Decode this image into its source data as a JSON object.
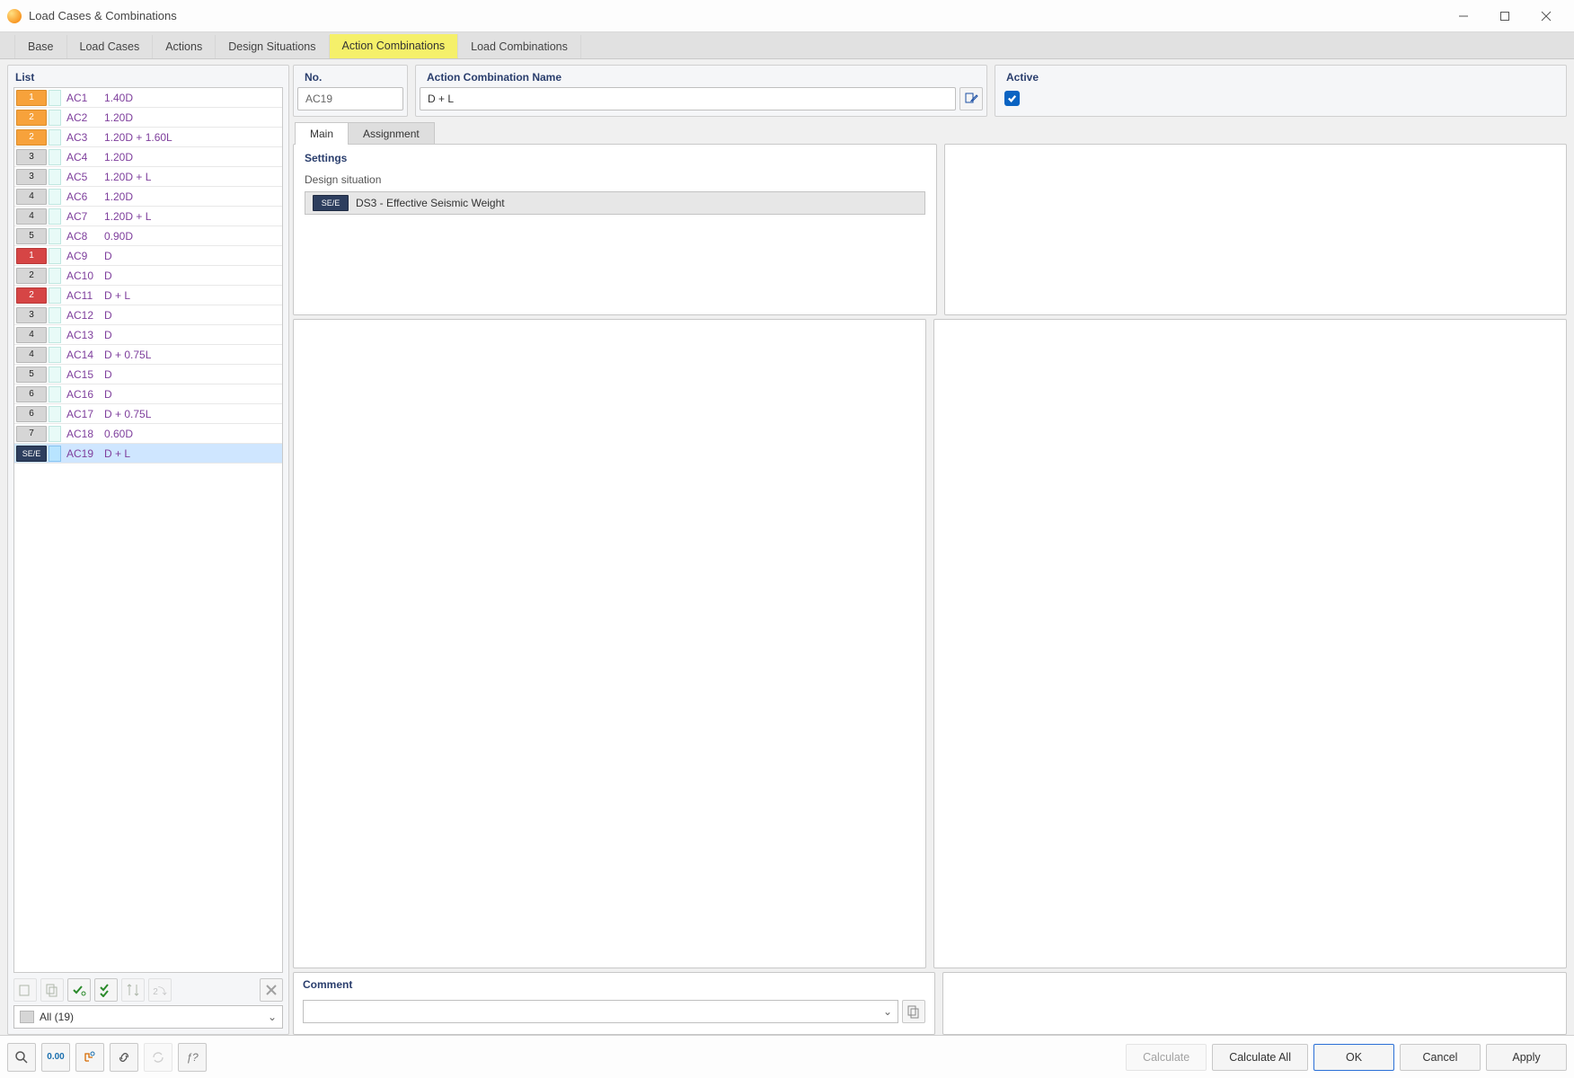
{
  "window": {
    "title": "Load Cases & Combinations"
  },
  "tabs": [
    {
      "label": "Base",
      "active": false
    },
    {
      "label": "Load Cases",
      "active": false
    },
    {
      "label": "Actions",
      "active": false
    },
    {
      "label": "Design Situations",
      "active": false
    },
    {
      "label": "Action Combinations",
      "active": true,
      "highlight": true
    },
    {
      "label": "Load Combinations",
      "active": false
    }
  ],
  "list": {
    "title": "List",
    "filter_label": "All (19)",
    "items": [
      {
        "badge": "1",
        "badge_type": "orange",
        "ac": "AC1",
        "desc": "1.40D",
        "selected": false
      },
      {
        "badge": "2",
        "badge_type": "orange",
        "ac": "AC2",
        "desc": "1.20D",
        "selected": false
      },
      {
        "badge": "2",
        "badge_type": "orange",
        "ac": "AC3",
        "desc": "1.20D + 1.60L",
        "selected": false
      },
      {
        "badge": "3",
        "badge_type": "gray",
        "ac": "AC4",
        "desc": "1.20D",
        "selected": false
      },
      {
        "badge": "3",
        "badge_type": "gray",
        "ac": "AC5",
        "desc": "1.20D + L",
        "selected": false
      },
      {
        "badge": "4",
        "badge_type": "gray",
        "ac": "AC6",
        "desc": "1.20D",
        "selected": false
      },
      {
        "badge": "4",
        "badge_type": "gray",
        "ac": "AC7",
        "desc": "1.20D + L",
        "selected": false
      },
      {
        "badge": "5",
        "badge_type": "gray",
        "ac": "AC8",
        "desc": "0.90D",
        "selected": false
      },
      {
        "badge": "1",
        "badge_type": "red",
        "ac": "AC9",
        "desc": "D",
        "selected": false
      },
      {
        "badge": "2",
        "badge_type": "gray",
        "ac": "AC10",
        "desc": "D",
        "selected": false
      },
      {
        "badge": "2",
        "badge_type": "red",
        "ac": "AC11",
        "desc": "D + L",
        "selected": false
      },
      {
        "badge": "3",
        "badge_type": "gray",
        "ac": "AC12",
        "desc": "D",
        "selected": false
      },
      {
        "badge": "4",
        "badge_type": "gray",
        "ac": "AC13",
        "desc": "D",
        "selected": false
      },
      {
        "badge": "4",
        "badge_type": "gray",
        "ac": "AC14",
        "desc": "D + 0.75L",
        "selected": false
      },
      {
        "badge": "5",
        "badge_type": "gray",
        "ac": "AC15",
        "desc": "D",
        "selected": false
      },
      {
        "badge": "6",
        "badge_type": "gray",
        "ac": "AC16",
        "desc": "D",
        "selected": false
      },
      {
        "badge": "6",
        "badge_type": "gray",
        "ac": "AC17",
        "desc": "D + 0.75L",
        "selected": false
      },
      {
        "badge": "7",
        "badge_type": "gray",
        "ac": "AC18",
        "desc": "0.60D",
        "selected": false
      },
      {
        "badge": "SE/E",
        "badge_type": "navy",
        "ac": "AC19",
        "desc": "D + L",
        "selected": true
      }
    ]
  },
  "form": {
    "no_header": "No.",
    "no_value": "AC19",
    "name_header": "Action Combination Name",
    "name_value": "D + L",
    "active_header": "Active",
    "active_checked": true,
    "subtabs": [
      {
        "label": "Main",
        "active": true
      },
      {
        "label": "Assignment",
        "active": false
      }
    ],
    "settings_header": "Settings",
    "design_situation_label": "Design situation",
    "design_situation_badge": "SE/E",
    "design_situation_value": "DS3 - Effective Seismic Weight",
    "comment_header": "Comment",
    "comment_value": ""
  },
  "footer": {
    "calculate": "Calculate",
    "calculate_all": "Calculate All",
    "ok": "OK",
    "cancel": "Cancel",
    "apply": "Apply"
  }
}
